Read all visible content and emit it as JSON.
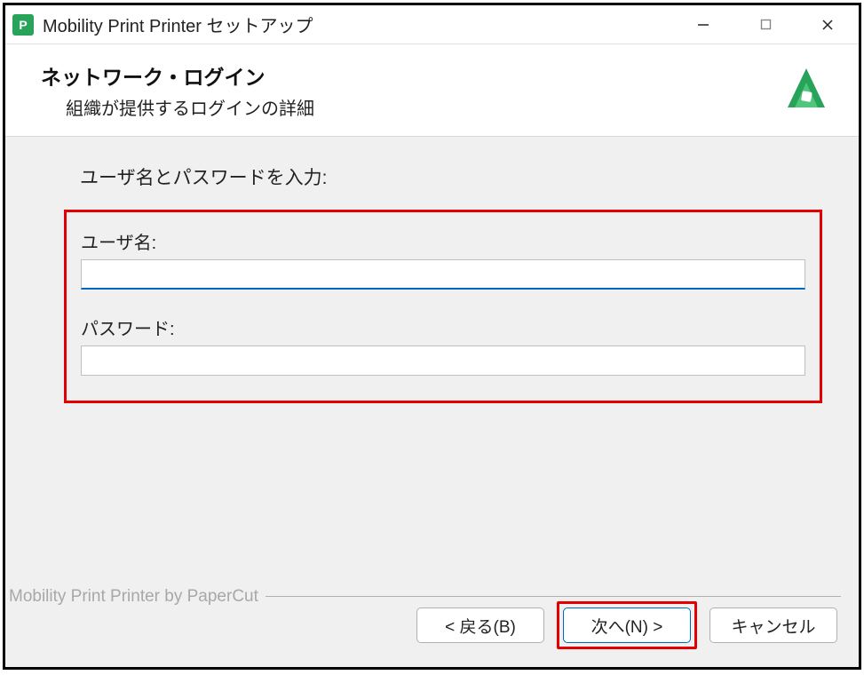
{
  "titlebar": {
    "app_icon_letter": "P",
    "title": "Mobility Print Printer セットアップ"
  },
  "header": {
    "title": "ネットワーク・ログイン",
    "subtitle": "組織が提供するログインの詳細"
  },
  "content": {
    "instruction": "ユーザ名とパスワードを入力:",
    "username_label": "ユーザ名:",
    "username_value": "",
    "password_label": "パスワード:",
    "password_value": ""
  },
  "footer": {
    "brand_text": "Mobility Print Printer by PaperCut",
    "back_label": "< 戻る(B)",
    "next_label": "次へ(N) >",
    "cancel_label": "キャンセル"
  },
  "colors": {
    "accent_green": "#27a35a",
    "highlight_red": "#e40000",
    "focus_blue": "#0067c0"
  }
}
